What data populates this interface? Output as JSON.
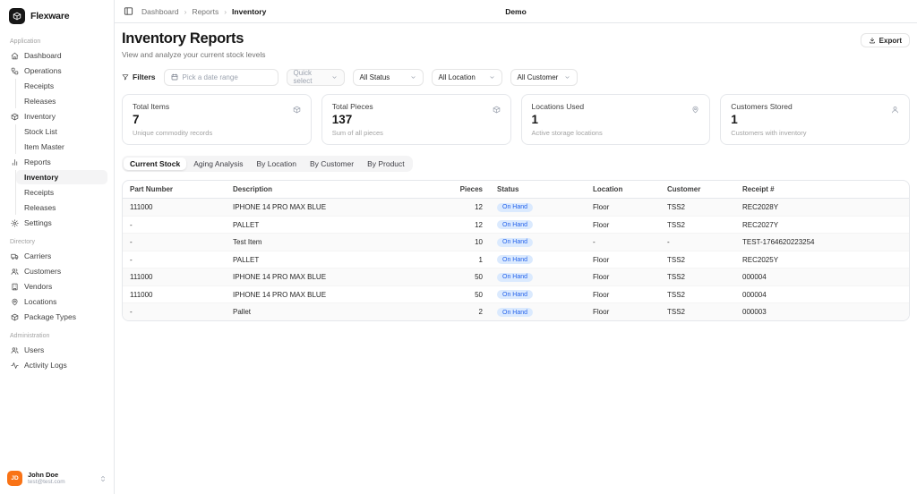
{
  "brand": {
    "name": "Flexware"
  },
  "colors": {
    "badge_bg": "#dbeafe",
    "badge_text": "#2563eb",
    "avatar_bg": "#f97316"
  },
  "sidebar": {
    "section_application": "Application",
    "section_directory": "Directory",
    "section_administration": "Administration",
    "items": {
      "dashboard": "Dashboard",
      "operations": "Operations",
      "op_receipts": "Receipts",
      "op_releases": "Releases",
      "inventory": "Inventory",
      "stock_list": "Stock List",
      "item_master": "Item Master",
      "reports": "Reports",
      "rep_inventory": "Inventory",
      "rep_receipts": "Receipts",
      "rep_releases": "Releases",
      "settings": "Settings",
      "carriers": "Carriers",
      "customers": "Customers",
      "vendors": "Vendors",
      "locations": "Locations",
      "package_types": "Package Types",
      "users": "Users",
      "activity_logs": "Activity Logs"
    }
  },
  "user": {
    "name": "John Doe",
    "email": "test@test.com",
    "initials": "JD"
  },
  "topbar": {
    "breadcrumb": {
      "level1": "Dashboard",
      "level2": "Reports",
      "level3": "Inventory"
    },
    "env": "Demo"
  },
  "page": {
    "title": "Inventory Reports",
    "subtitle": "View and analyze your current stock levels",
    "export_label": "Export"
  },
  "filters": {
    "label": "Filters",
    "date_placeholder": "Pick a date range",
    "quick_select": "Quick select",
    "status": "All Status",
    "location": "All Location",
    "customer": "All Customer"
  },
  "stats": {
    "items": [
      {
        "title": "Total Items",
        "value": "7",
        "subtitle": "Unique commodity records"
      },
      {
        "title": "Total Pieces",
        "value": "137",
        "subtitle": "Sum of all pieces"
      },
      {
        "title": "Locations Used",
        "value": "1",
        "subtitle": "Active storage locations"
      },
      {
        "title": "Customers Stored",
        "value": "1",
        "subtitle": "Customers with inventory"
      }
    ]
  },
  "tabs": {
    "items": [
      "Current Stock",
      "Aging Analysis",
      "By Location",
      "By Customer",
      "By Product"
    ],
    "active": "Current Stock"
  },
  "table": {
    "columns": [
      "Part Number",
      "Description",
      "Pieces",
      "Status",
      "Location",
      "Customer",
      "Receipt #"
    ],
    "rows": [
      {
        "part": "111000",
        "description": "IPHONE 14 PRO MAX BLUE",
        "pieces": "12",
        "status": "On Hand",
        "location": "Floor",
        "customer": "TSS2",
        "receipt": "REC2028Y"
      },
      {
        "part": "-",
        "description": "PALLET",
        "pieces": "12",
        "status": "On Hand",
        "location": "Floor",
        "customer": "TSS2",
        "receipt": "REC2027Y"
      },
      {
        "part": "-",
        "description": "Test Item",
        "pieces": "10",
        "status": "On Hand",
        "location": "-",
        "customer": "-",
        "receipt": "TEST-1764620223254"
      },
      {
        "part": "-",
        "description": "PALLET",
        "pieces": "1",
        "status": "On Hand",
        "location": "Floor",
        "customer": "TSS2",
        "receipt": "REC2025Y"
      },
      {
        "part": "111000",
        "description": "IPHONE 14 PRO MAX BLUE",
        "pieces": "50",
        "status": "On Hand",
        "location": "Floor",
        "customer": "TSS2",
        "receipt": "000004"
      },
      {
        "part": "111000",
        "description": "IPHONE 14 PRO MAX BLUE",
        "pieces": "50",
        "status": "On Hand",
        "location": "Floor",
        "customer": "TSS2",
        "receipt": "000004"
      },
      {
        "part": "-",
        "description": "Pallet",
        "pieces": "2",
        "status": "On Hand",
        "location": "Floor",
        "customer": "TSS2",
        "receipt": "000003"
      }
    ]
  }
}
